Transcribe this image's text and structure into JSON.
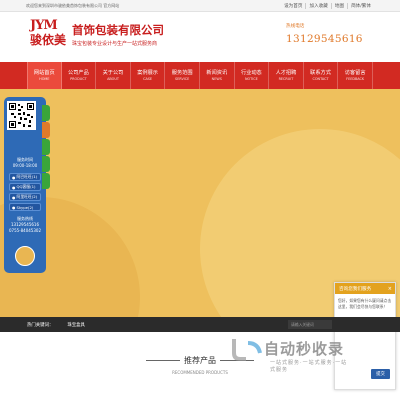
{
  "topbar": {
    "welcome": "欢迎您来到深圳市骏依美首饰包装有限公司 官方网站",
    "links": [
      "设为首页",
      "加入收藏",
      "地图",
      "简体/繁体"
    ]
  },
  "header": {
    "logo_latin": "JYM",
    "logo_cn": "骏依美",
    "company_name": "首饰包装有限公司",
    "slogan": "珠宝包装专业设计与生产一站式服务商",
    "hotline_label": "热线电话",
    "hotline_number": "13129545616"
  },
  "nav": [
    {
      "cn": "网站首页",
      "en": "HOME",
      "active": true
    },
    {
      "cn": "公司产品",
      "en": "PRODUCT"
    },
    {
      "cn": "关于公司",
      "en": "ABOUT"
    },
    {
      "cn": "案例展示",
      "en": "CASE"
    },
    {
      "cn": "服务范围",
      "en": "SERVICE"
    },
    {
      "cn": "新闻资讯",
      "en": "NEWS"
    },
    {
      "cn": "行业动态",
      "en": "NOTICE"
    },
    {
      "cn": "人才招聘",
      "en": "RECRUIT"
    },
    {
      "cn": "联系方式",
      "en": "CONTACT"
    },
    {
      "cn": "访客留言",
      "en": "FEEDBACK"
    }
  ],
  "float_widget": {
    "service_time_label": "服务时间",
    "service_time": "09:00-18:00",
    "buttons": [
      "阿巴旺旺(1)",
      "QQ客服(1)",
      "阿里旺旺(2)",
      "Skype(2)"
    ],
    "phone_label": "服务热线",
    "phone_1": "13129545616",
    "phone_2": "0755-84045302",
    "tab_colors": [
      "#3aa53a",
      "#e07a2a",
      "#3aa53a",
      "#3aa53a",
      "#3aa53a"
    ]
  },
  "chat": {
    "title": "咨询您我们服务",
    "close": "×",
    "message": "您好，如果您有什么疑问请点击这里，我们会尽快与您联系！",
    "button": "提交"
  },
  "hotbar": {
    "label": "热门关键词：",
    "keyword": "珠宝盒具",
    "search_placeholder": "请输入关键词"
  },
  "section": {
    "title": "推荐产品",
    "subtitle": "RECOMMENDED PRODUCTS"
  },
  "watermark": {
    "text": "自动秒收录",
    "sub": "一站式服务·一站式服务·一站式服务"
  },
  "colors": {
    "brand_red": "#c81e1e",
    "nav_red": "#d22a22",
    "banner_yellow": "#eec05d",
    "float_blue": "#2e6ab6",
    "hotline_orange": "#e0792a"
  }
}
